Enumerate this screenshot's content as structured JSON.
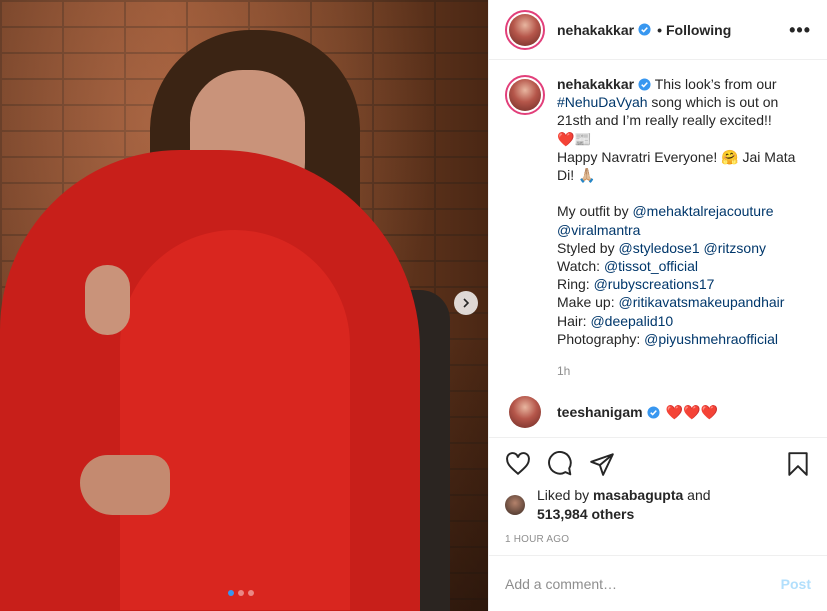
{
  "header": {
    "username": "nehakakkar",
    "following_label": "Following",
    "separator": "•",
    "more_label": "•••"
  },
  "caption": {
    "username": "nehakakkar",
    "line1": "This look’s from our",
    "hashtag": "#NehuDaVyah",
    "line2": " song which is out on 21sth and I’m really really excited!!",
    "emoji_line": "❤️📰",
    "line3": "Happy Navratri Everyone! 🤗 Jai Mata Di! 🙏🏼",
    "outfit_label": "My outfit by ",
    "outfit_link1": "@mehaktalrejacouture",
    "outfit_link2": "@viralmantra",
    "styled_label": "Styled by ",
    "styled_link1": "@styledose1",
    "styled_link2": "@ritzsony",
    "watch_label": "Watch: ",
    "watch_link": "@tissot_official",
    "ring_label": "Ring: ",
    "ring_link": "@rubyscreations17",
    "makeup_label": "Make up: ",
    "makeup_link": "@ritikavatsmakeupandhair",
    "hair_label": "Hair: ",
    "hair_link": "@deepalid10",
    "photo_label": "Photography: ",
    "photo_link": "@piyushmehraofficial",
    "time": "1h"
  },
  "reply": {
    "username": "teeshanigam",
    "hearts": "❤️❤️❤️"
  },
  "likes": {
    "prefix": "Liked by ",
    "user": "masabagupta",
    "mid": " and",
    "count": "513,984 others"
  },
  "date": "1 HOUR AGO",
  "comment_box": {
    "placeholder": "Add a comment…",
    "post_label": "Post"
  },
  "carousel": {
    "total": 3,
    "active": 1
  },
  "colors": {
    "verified": "#3897f0",
    "link": "#00376b",
    "post_disabled": "#b2dffc"
  }
}
